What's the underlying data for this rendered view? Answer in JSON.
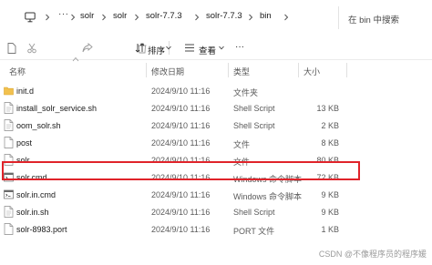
{
  "address": {
    "ellipsis": "···",
    "breadcrumbs": [
      "solr",
      "solr",
      "solr-7.7.3",
      "solr-7.7.3",
      "bin"
    ],
    "search_placeholder": "在 bin 中搜索"
  },
  "toolbar": {
    "sort_label": "排序",
    "view_label": "查看",
    "more_label": "···"
  },
  "columns": {
    "name": "名称",
    "date": "修改日期",
    "type": "类型",
    "size": "大小"
  },
  "files": [
    {
      "name": "init.d",
      "date": "2024/9/10 11:16",
      "type": "文件夹",
      "size": "",
      "icon": "folder-icon"
    },
    {
      "name": "install_solr_service.sh",
      "date": "2024/9/10 11:16",
      "type": "Shell Script",
      "size": "13 KB",
      "icon": "script-file-icon"
    },
    {
      "name": "oom_solr.sh",
      "date": "2024/9/10 11:16",
      "type": "Shell Script",
      "size": "2 KB",
      "icon": "script-file-icon"
    },
    {
      "name": "post",
      "date": "2024/9/10 11:16",
      "type": "文件",
      "size": "8 KB",
      "icon": "file-icon"
    },
    {
      "name": "solr",
      "date": "2024/9/10 11:16",
      "type": "文件",
      "size": "80 KB",
      "icon": "file-icon"
    },
    {
      "name": "solr.cmd",
      "date": "2024/9/10 11:16",
      "type": "Windows 命令脚本",
      "size": "72 KB",
      "icon": "cmd-file-icon"
    },
    {
      "name": "solr.in.cmd",
      "date": "2024/9/10 11:16",
      "type": "Windows 命令脚本",
      "size": "9 KB",
      "icon": "cmd-file-icon"
    },
    {
      "name": "solr.in.sh",
      "date": "2024/9/10 11:16",
      "type": "Shell Script",
      "size": "9 KB",
      "icon": "script-file-icon"
    },
    {
      "name": "solr-8983.port",
      "date": "2024/9/10 11:16",
      "type": "PORT 文件",
      "size": "1 KB",
      "icon": "file-icon"
    }
  ],
  "watermark": "CSDN @不像程序员的程序媛",
  "colors": {
    "highlight": "#e0232a",
    "folder": "#f2c14e"
  }
}
